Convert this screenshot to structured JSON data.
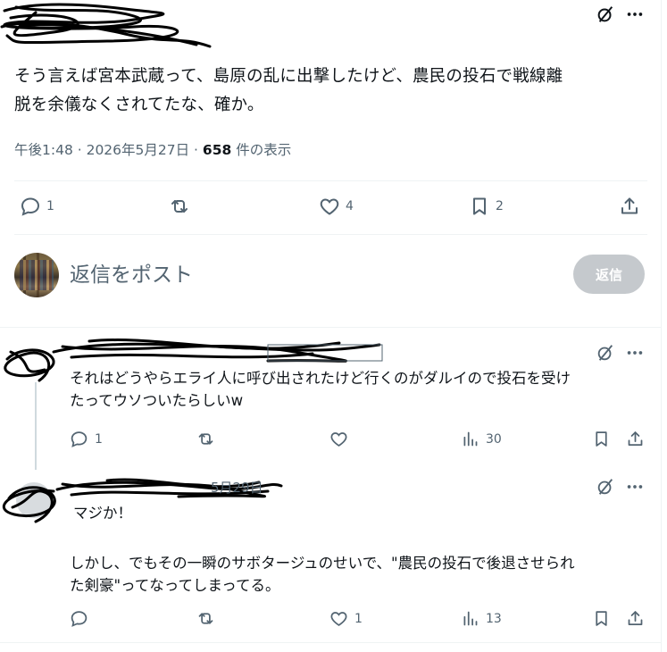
{
  "main_post": {
    "text_line1": "そう言えば宮本武蔵って、島原の乱に出撃したけど、農民の投石で戦線離",
    "text_line2": "脱を余儀なくされてたな、確か。",
    "meta_time": "午後1:48 · 2026年5月27日 · ",
    "meta_views_count": "658",
    "meta_views_label": " 件の表示",
    "actions": {
      "replies": "1",
      "reposts": "",
      "likes": "4",
      "bookmarks": "2"
    }
  },
  "composer": {
    "placeholder": "返信をポスト",
    "button_label": "返信"
  },
  "replies": [
    {
      "text_line1": "それはどうやらエライ人に呼び出されたけど行くのがダルイので投石を受け",
      "text_line2": "たってウソついたらしいw",
      "actions": {
        "replies": "1",
        "reposts": "",
        "likes": "",
        "views": "30"
      }
    },
    {
      "text_line1": "マジか！",
      "text_line2": "",
      "text_line3": "しかし、でもその一瞬のサボタージュのせいで、\"農民の投石で後退させられ",
      "text_line4": "た剣豪\"ってなってしまってる。",
      "header_visible_fragment": "5月29日",
      "actions": {
        "replies": "",
        "reposts": "",
        "likes": "1",
        "views": "13"
      }
    }
  ],
  "icons": [
    "grok-icon",
    "more-icon",
    "reply-icon",
    "repost-icon",
    "like-icon",
    "bookmark-icon",
    "share-icon",
    "views-icon"
  ],
  "colors": {
    "text": "#0f1419",
    "secondary": "#536471",
    "divider": "#eff3f4",
    "button_disabled": "#c5c9cd"
  }
}
